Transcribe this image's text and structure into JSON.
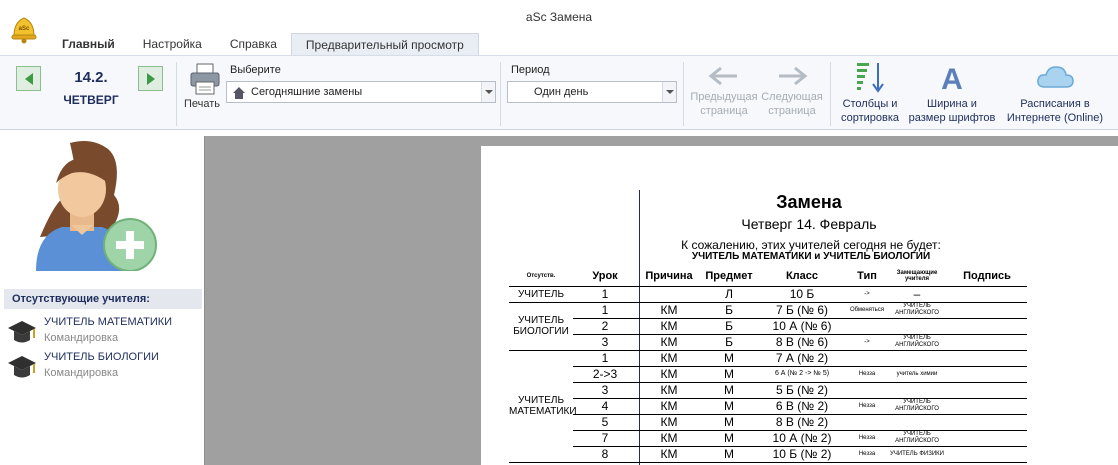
{
  "window": {
    "title": "aSc Замена"
  },
  "tabs": [
    {
      "label": "Главный"
    },
    {
      "label": "Настройка"
    },
    {
      "label": "Справка"
    },
    {
      "label": "Предварительный просмотр"
    }
  ],
  "ribbon": {
    "date": "14.2.",
    "weekday": "ЧЕТВЕРГ",
    "print_label": "Печать",
    "select_label": "Выберите",
    "select_value": "Сегодняшние замены",
    "period_label": "Период",
    "period_value": "Один день",
    "prev_page": [
      "Предыдущая",
      "страница"
    ],
    "next_page": [
      "Следующая",
      "страница"
    ],
    "columns": [
      "Столбцы и",
      "сортировка"
    ],
    "fonts": [
      "Ширина и",
      "размер шрифтов"
    ],
    "online": [
      "Расписания в",
      "Интернете (Online)"
    ]
  },
  "sidebar": {
    "absent_header": "Отсутствующие учителя:",
    "teachers": [
      {
        "name": "УЧИТЕЛЬ МАТЕМАТИКИ",
        "reason": "Командировка"
      },
      {
        "name": "УЧИТЕЛЬ БИОЛОГИИ",
        "reason": "Командировка"
      }
    ]
  },
  "document": {
    "title": "Замена",
    "date": "Четверг 14. Февраль",
    "note": "К сожалению, этих учителей сегодня не будет:",
    "absent_list": "УЧИТЕЛЬ МАТЕМАТИКИ и УЧИТЕЛЬ БИОЛОГИИ",
    "headers": {
      "absent": "Отсутств.",
      "lesson": "Урок",
      "reason": "Причина",
      "subject": "Предмет",
      "class": "Класс",
      "type": "Тип",
      "substitute": "Замещающие учителя",
      "signature": "Подпись"
    },
    "groups": [
      {
        "teacher": "УЧИТЕЛЬ",
        "rows": [
          {
            "lesson": "1",
            "reason": "",
            "subject": "Л",
            "class": "10 Б",
            "type": "->",
            "sub": "–"
          }
        ]
      },
      {
        "teacher": "УЧИТЕЛЬ БИОЛОГИИ",
        "rows": [
          {
            "lesson": "1",
            "reason": "КМ",
            "subject": "Б",
            "class": "7 Б (№ 6)",
            "type": "Обменяться",
            "sub": "УЧИТЕЛЬ АНГЛИЙСКОГО"
          },
          {
            "lesson": "2",
            "reason": "КМ",
            "subject": "Б",
            "class": "10 А (№ 6)",
            "type": "",
            "sub": ""
          },
          {
            "lesson": "3",
            "reason": "КМ",
            "subject": "Б",
            "class": "8 В (№ 6)",
            "type": "->",
            "sub": "УЧИТЕЛЬ АНГЛИЙСКОГО"
          }
        ]
      },
      {
        "teacher": "УЧИТЕЛЬ МАТЕМАТИКИ",
        "rows": [
          {
            "lesson": "1",
            "reason": "КМ",
            "subject": "М",
            "class": "7 А (№ 2)",
            "type": "",
            "sub": ""
          },
          {
            "lesson": "2->3",
            "reason": "КМ",
            "subject": "М",
            "class": "6 А (№ 2 -> № 5)",
            "type": "Незза",
            "sub": "учитель химии"
          },
          {
            "lesson": "3",
            "reason": "КМ",
            "subject": "М",
            "class": "5 Б (№ 2)",
            "type": "",
            "sub": ""
          },
          {
            "lesson": "4",
            "reason": "КМ",
            "subject": "М",
            "class": "6 В (№ 2)",
            "type": "Незза",
            "sub": "УЧИТЕЛЬ АНГЛИЙСКОГО"
          },
          {
            "lesson": "5",
            "reason": "КМ",
            "subject": "М",
            "class": "8 В (№ 2)",
            "type": "",
            "sub": ""
          },
          {
            "lesson": "7",
            "reason": "КМ",
            "subject": "М",
            "class": "10 А (№ 2)",
            "type": "Незза",
            "sub": "УЧИТЕЛЬ АНГЛИЙСКОГО"
          },
          {
            "lesson": "8",
            "reason": "КМ",
            "subject": "М",
            "class": "10 Б (№ 2)",
            "type": "Незза",
            "sub": "УЧИТЕЛЬ ФИЗИКИ"
          }
        ]
      }
    ]
  },
  "colors": {
    "navy": "#1e2d5c",
    "green": "#8bbf8e",
    "preview_bg": "#a0a0a0"
  }
}
